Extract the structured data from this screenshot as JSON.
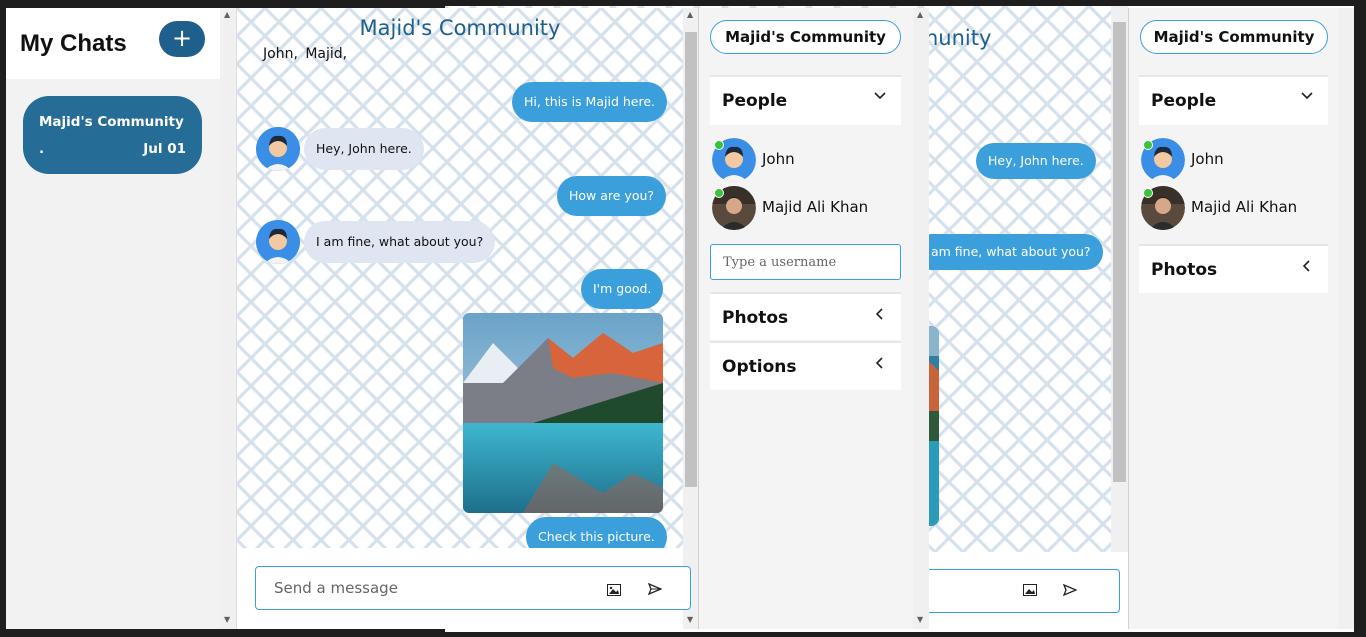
{
  "left_panel": {
    "title": "My Chats",
    "add_button": "+",
    "chat_card": {
      "name": "Majid's Community",
      "preview": ".",
      "date": "Jul 01"
    }
  },
  "chat": {
    "title": "Majid's Community",
    "participants": "John,  Majid,",
    "messages": [
      {
        "text": "Hi, this is Majid here.",
        "from": "me"
      },
      {
        "text": "Hey, John here.",
        "from": "John"
      },
      {
        "text": "How are you?",
        "from": "me"
      },
      {
        "text": "I am fine, what about you?",
        "from": "John"
      },
      {
        "text": "I'm good.",
        "from": "me"
      },
      {
        "text": "Check this picture.",
        "from": "me"
      }
    ],
    "message_placeholder": "Send a message"
  },
  "sidebar": {
    "community_name": "Majid's Community",
    "people_label": "People",
    "people": [
      {
        "name": "John",
        "online": true
      },
      {
        "name": "Majid Ali Khan",
        "online": true
      }
    ],
    "username_placeholder": "Type a username",
    "photos_label": "Photos",
    "options_label": "Options"
  },
  "back_window": {
    "title_fragment": "nunity",
    "bubble_1": "Hey, John here.",
    "bubble_2": "am fine, what about you?",
    "community_name": "Majid's Community",
    "people_label": "People",
    "people": [
      "John",
      "Majid Ali Khan"
    ],
    "photos_label": "Photos"
  },
  "colors": {
    "brand_dark": "#1f5f8b",
    "bubble_mine": "#3a9fdb",
    "bubble_theirs": "#dfe6f1",
    "online": "#3bc23b"
  }
}
